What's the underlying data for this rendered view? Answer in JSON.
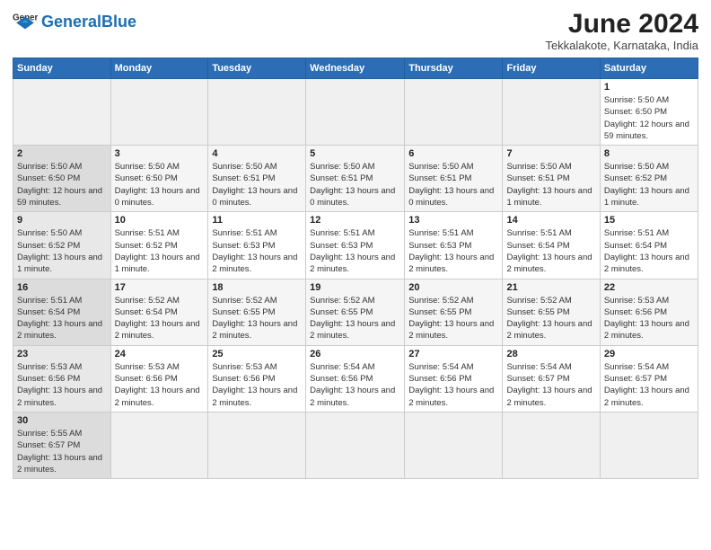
{
  "header": {
    "logo_general": "General",
    "logo_blue": "Blue",
    "title": "June 2024",
    "subtitle": "Tekkalakote, Karnataka, India"
  },
  "weekdays": [
    "Sunday",
    "Monday",
    "Tuesday",
    "Wednesday",
    "Thursday",
    "Friday",
    "Saturday"
  ],
  "weeks": [
    [
      {
        "day": "",
        "info": ""
      },
      {
        "day": "",
        "info": ""
      },
      {
        "day": "",
        "info": ""
      },
      {
        "day": "",
        "info": ""
      },
      {
        "day": "",
        "info": ""
      },
      {
        "day": "",
        "info": ""
      },
      {
        "day": "1",
        "info": "Sunrise: 5:50 AM\nSunset: 6:50 PM\nDaylight: 12 hours\nand 59 minutes."
      }
    ],
    [
      {
        "day": "2",
        "info": "Sunrise: 5:50 AM\nSunset: 6:50 PM\nDaylight: 12 hours\nand 59 minutes."
      },
      {
        "day": "3",
        "info": "Sunrise: 5:50 AM\nSunset: 6:50 PM\nDaylight: 13 hours\nand 0 minutes."
      },
      {
        "day": "4",
        "info": "Sunrise: 5:50 AM\nSunset: 6:51 PM\nDaylight: 13 hours\nand 0 minutes."
      },
      {
        "day": "5",
        "info": "Sunrise: 5:50 AM\nSunset: 6:51 PM\nDaylight: 13 hours\nand 0 minutes."
      },
      {
        "day": "6",
        "info": "Sunrise: 5:50 AM\nSunset: 6:51 PM\nDaylight: 13 hours\nand 0 minutes."
      },
      {
        "day": "7",
        "info": "Sunrise: 5:50 AM\nSunset: 6:51 PM\nDaylight: 13 hours\nand 1 minute."
      },
      {
        "day": "8",
        "info": "Sunrise: 5:50 AM\nSunset: 6:52 PM\nDaylight: 13 hours\nand 1 minute."
      }
    ],
    [
      {
        "day": "9",
        "info": "Sunrise: 5:50 AM\nSunset: 6:52 PM\nDaylight: 13 hours\nand 1 minute."
      },
      {
        "day": "10",
        "info": "Sunrise: 5:51 AM\nSunset: 6:52 PM\nDaylight: 13 hours\nand 1 minute."
      },
      {
        "day": "11",
        "info": "Sunrise: 5:51 AM\nSunset: 6:53 PM\nDaylight: 13 hours\nand 2 minutes."
      },
      {
        "day": "12",
        "info": "Sunrise: 5:51 AM\nSunset: 6:53 PM\nDaylight: 13 hours\nand 2 minutes."
      },
      {
        "day": "13",
        "info": "Sunrise: 5:51 AM\nSunset: 6:53 PM\nDaylight: 13 hours\nand 2 minutes."
      },
      {
        "day": "14",
        "info": "Sunrise: 5:51 AM\nSunset: 6:54 PM\nDaylight: 13 hours\nand 2 minutes."
      },
      {
        "day": "15",
        "info": "Sunrise: 5:51 AM\nSunset: 6:54 PM\nDaylight: 13 hours\nand 2 minutes."
      }
    ],
    [
      {
        "day": "16",
        "info": "Sunrise: 5:51 AM\nSunset: 6:54 PM\nDaylight: 13 hours\nand 2 minutes."
      },
      {
        "day": "17",
        "info": "Sunrise: 5:52 AM\nSunset: 6:54 PM\nDaylight: 13 hours\nand 2 minutes."
      },
      {
        "day": "18",
        "info": "Sunrise: 5:52 AM\nSunset: 6:55 PM\nDaylight: 13 hours\nand 2 minutes."
      },
      {
        "day": "19",
        "info": "Sunrise: 5:52 AM\nSunset: 6:55 PM\nDaylight: 13 hours\nand 2 minutes."
      },
      {
        "day": "20",
        "info": "Sunrise: 5:52 AM\nSunset: 6:55 PM\nDaylight: 13 hours\nand 2 minutes."
      },
      {
        "day": "21",
        "info": "Sunrise: 5:52 AM\nSunset: 6:55 PM\nDaylight: 13 hours\nand 2 minutes."
      },
      {
        "day": "22",
        "info": "Sunrise: 5:53 AM\nSunset: 6:56 PM\nDaylight: 13 hours\nand 2 minutes."
      }
    ],
    [
      {
        "day": "23",
        "info": "Sunrise: 5:53 AM\nSunset: 6:56 PM\nDaylight: 13 hours\nand 2 minutes."
      },
      {
        "day": "24",
        "info": "Sunrise: 5:53 AM\nSunset: 6:56 PM\nDaylight: 13 hours\nand 2 minutes."
      },
      {
        "day": "25",
        "info": "Sunrise: 5:53 AM\nSunset: 6:56 PM\nDaylight: 13 hours\nand 2 minutes."
      },
      {
        "day": "26",
        "info": "Sunrise: 5:54 AM\nSunset: 6:56 PM\nDaylight: 13 hours\nand 2 minutes."
      },
      {
        "day": "27",
        "info": "Sunrise: 5:54 AM\nSunset: 6:56 PM\nDaylight: 13 hours\nand 2 minutes."
      },
      {
        "day": "28",
        "info": "Sunrise: 5:54 AM\nSunset: 6:57 PM\nDaylight: 13 hours\nand 2 minutes."
      },
      {
        "day": "29",
        "info": "Sunrise: 5:54 AM\nSunset: 6:57 PM\nDaylight: 13 hours\nand 2 minutes."
      }
    ],
    [
      {
        "day": "30",
        "info": "Sunrise: 5:55 AM\nSunset: 6:57 PM\nDaylight: 13 hours\nand 2 minutes."
      },
      {
        "day": "",
        "info": ""
      },
      {
        "day": "",
        "info": ""
      },
      {
        "day": "",
        "info": ""
      },
      {
        "day": "",
        "info": ""
      },
      {
        "day": "",
        "info": ""
      },
      {
        "day": "",
        "info": ""
      }
    ]
  ]
}
